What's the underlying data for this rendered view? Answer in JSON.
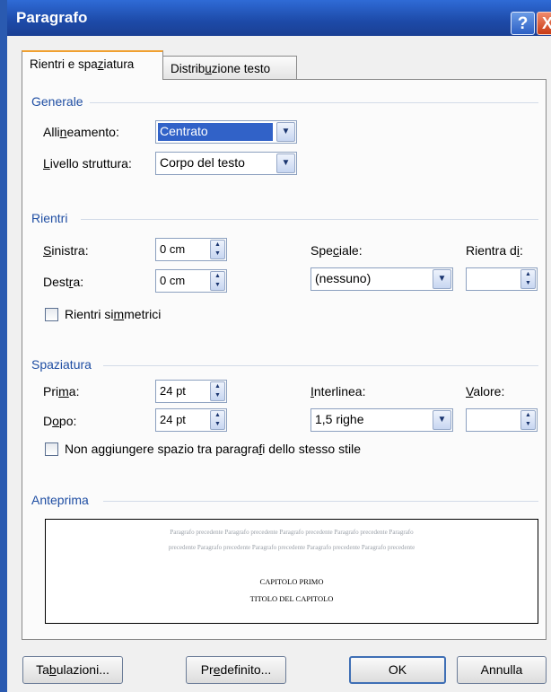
{
  "window": {
    "title": "Paragrafo",
    "help_label": "?",
    "close_label": "X"
  },
  "tabs": [
    {
      "label_pre": "Rientri e spa",
      "label_ul": "z",
      "label_post": "iatura",
      "active": true
    },
    {
      "label_pre": "Distrib",
      "label_ul": "u",
      "label_post": "zione testo",
      "active": false
    }
  ],
  "generale": {
    "heading": "Generale",
    "alignment": {
      "label_pre": "Alli",
      "label_ul": "n",
      "label_post": "eamento:",
      "value": "Centrato"
    },
    "outline_level": {
      "label_pre": "",
      "label_ul": "L",
      "label_post": "ivello struttura:",
      "value": "Corpo del testo"
    }
  },
  "rientri": {
    "heading": "Rientri",
    "left": {
      "label_pre": "",
      "label_ul": "S",
      "label_post": "inistra:",
      "value": "0 cm"
    },
    "right": {
      "label_pre": "Dest",
      "label_ul": "r",
      "label_post": "a:",
      "value": "0 cm"
    },
    "special": {
      "label_pre": "Spe",
      "label_ul": "c",
      "label_post": "iale:",
      "value": "(nessuno)"
    },
    "indent_by": {
      "label_pre": "Rientra d",
      "label_ul": "i",
      "label_post": ":",
      "value": ""
    },
    "mirror": {
      "label_pre": "Rientri si",
      "label_ul": "m",
      "label_post": "metrici",
      "checked": false
    }
  },
  "spaziatura": {
    "heading": "Spaziatura",
    "before": {
      "label_pre": "Pri",
      "label_ul": "m",
      "label_post": "a:",
      "value": "24 pt"
    },
    "after": {
      "label_pre": "D",
      "label_ul": "o",
      "label_post": "po:",
      "value": "24 pt"
    },
    "line_spacing": {
      "label_pre": "",
      "label_ul": "I",
      "label_post": "nterlinea:",
      "value": "1,5 righe"
    },
    "at": {
      "label_pre": "",
      "label_ul": "V",
      "label_post": "alore:",
      "value": ""
    },
    "no_space": {
      "label_pre": "Non aggiungere spazio tra paragra",
      "label_ul": "f",
      "label_post": "i dello stesso stile",
      "checked": false
    }
  },
  "anteprima": {
    "heading": "Anteprima",
    "prev_line1": "Paragrafo precedente Paragrafo precedente Paragrafo precedente Paragrafo precedente Paragrafo",
    "prev_line2": "precedente Paragrafo precedente Paragrafo precedente Paragrafo precedente Paragrafo precedente",
    "main_line1": "CAPITOLO PRIMO",
    "main_line2": "TITOLO DEL CAPITOLO"
  },
  "buttons": {
    "tabs": {
      "label_pre": "Ta",
      "label_ul": "b",
      "label_post": "ulazioni..."
    },
    "default": {
      "label_pre": "Pr",
      "label_ul": "e",
      "label_post": "definito..."
    },
    "ok": "OK",
    "cancel": "Annulla"
  },
  "colors": {
    "titlebar": "#1d4aa8",
    "section_heading": "#1f4ea3",
    "selection": "#3162c8",
    "tab_accent": "#f0a030"
  },
  "icons": {
    "dropdown": "chevron-down-icon",
    "spinner": "spin-up-down-icon",
    "help": "question-icon",
    "close": "close-icon"
  }
}
